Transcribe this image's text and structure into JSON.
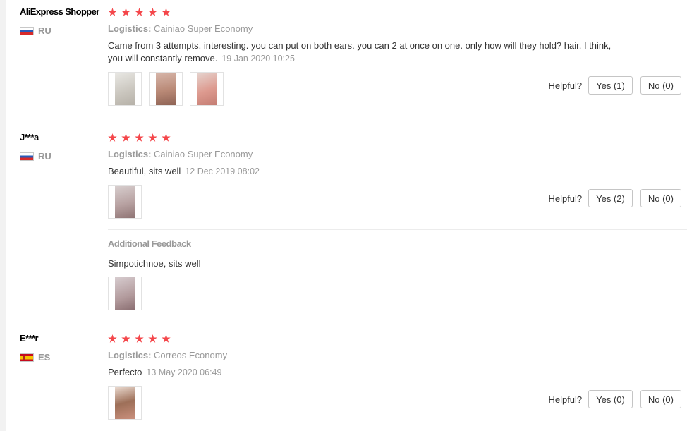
{
  "helpful_label": "Helpful?",
  "logistics_label": "Logistics:",
  "additional_feedback_label": "Additional Feedback",
  "reviews": [
    {
      "user": "AliExpress Shopper",
      "country": "RU",
      "stars": 5,
      "logistics": "Cainiao Super Economy",
      "text": "Came from 3 attempts. interesting. you can put on both ears. you can 2 at once on one. only how will they hold? hair, I think, you will constantly remove.",
      "date": "19 Jan 2020 10:25",
      "photos": 3,
      "yes": "Yes (1)",
      "no": "No (0)"
    },
    {
      "user": "J***a",
      "country": "RU",
      "stars": 5,
      "logistics": "Cainiao Super Economy",
      "text": "Beautiful, sits well",
      "date": "12 Dec 2019 08:02",
      "photos": 1,
      "yes": "Yes (2)",
      "no": "No (0)",
      "additional_text": "Simpotichnoe, sits well"
    },
    {
      "user": "E***r",
      "country": "ES",
      "stars": 5,
      "logistics": "Correos Economy",
      "text": "Perfecto",
      "date": "13 May 2020 06:49",
      "photos": 1,
      "yes": "Yes (0)",
      "no": "No (0)"
    }
  ],
  "colors": {
    "star": "#f4464a",
    "muted_text": "#999999",
    "divider": "#ececec"
  }
}
